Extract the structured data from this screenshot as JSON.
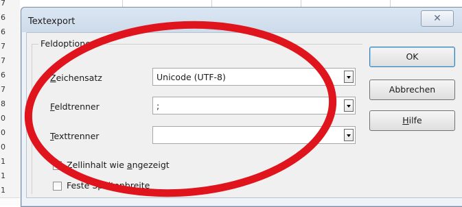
{
  "spreadsheet": {
    "row_numbers": [
      "7",
      "6",
      "6",
      "7",
      "7",
      "6",
      "7",
      "8",
      "0",
      "0",
      "0",
      "1",
      "1",
      "1"
    ]
  },
  "dialog": {
    "title": "Textexport",
    "close_glyph": "✕",
    "group_title": "Feldoptionen",
    "fields": [
      {
        "label": "Zeichensatz",
        "accel_index": 0,
        "value": "Unicode (UTF-8)"
      },
      {
        "label": "Feldtrenner",
        "accel_index": 0,
        "value": ";"
      },
      {
        "label": "Texttrenner",
        "accel_index": 0,
        "value": ""
      }
    ],
    "checkboxes": [
      {
        "label": "Zellinhalt wie angezeigt",
        "accel_index": 15,
        "checked": true
      },
      {
        "label": "Feste Spaltenbreite",
        "accel_index": 15,
        "checked": false
      }
    ],
    "buttons": [
      {
        "label": "OK",
        "accel_index": -1
      },
      {
        "label": "Abbrechen",
        "accel_index": -1
      },
      {
        "label": "Hilfe",
        "accel_index": 0
      }
    ]
  },
  "annotation": {
    "color": "#e0141c"
  }
}
